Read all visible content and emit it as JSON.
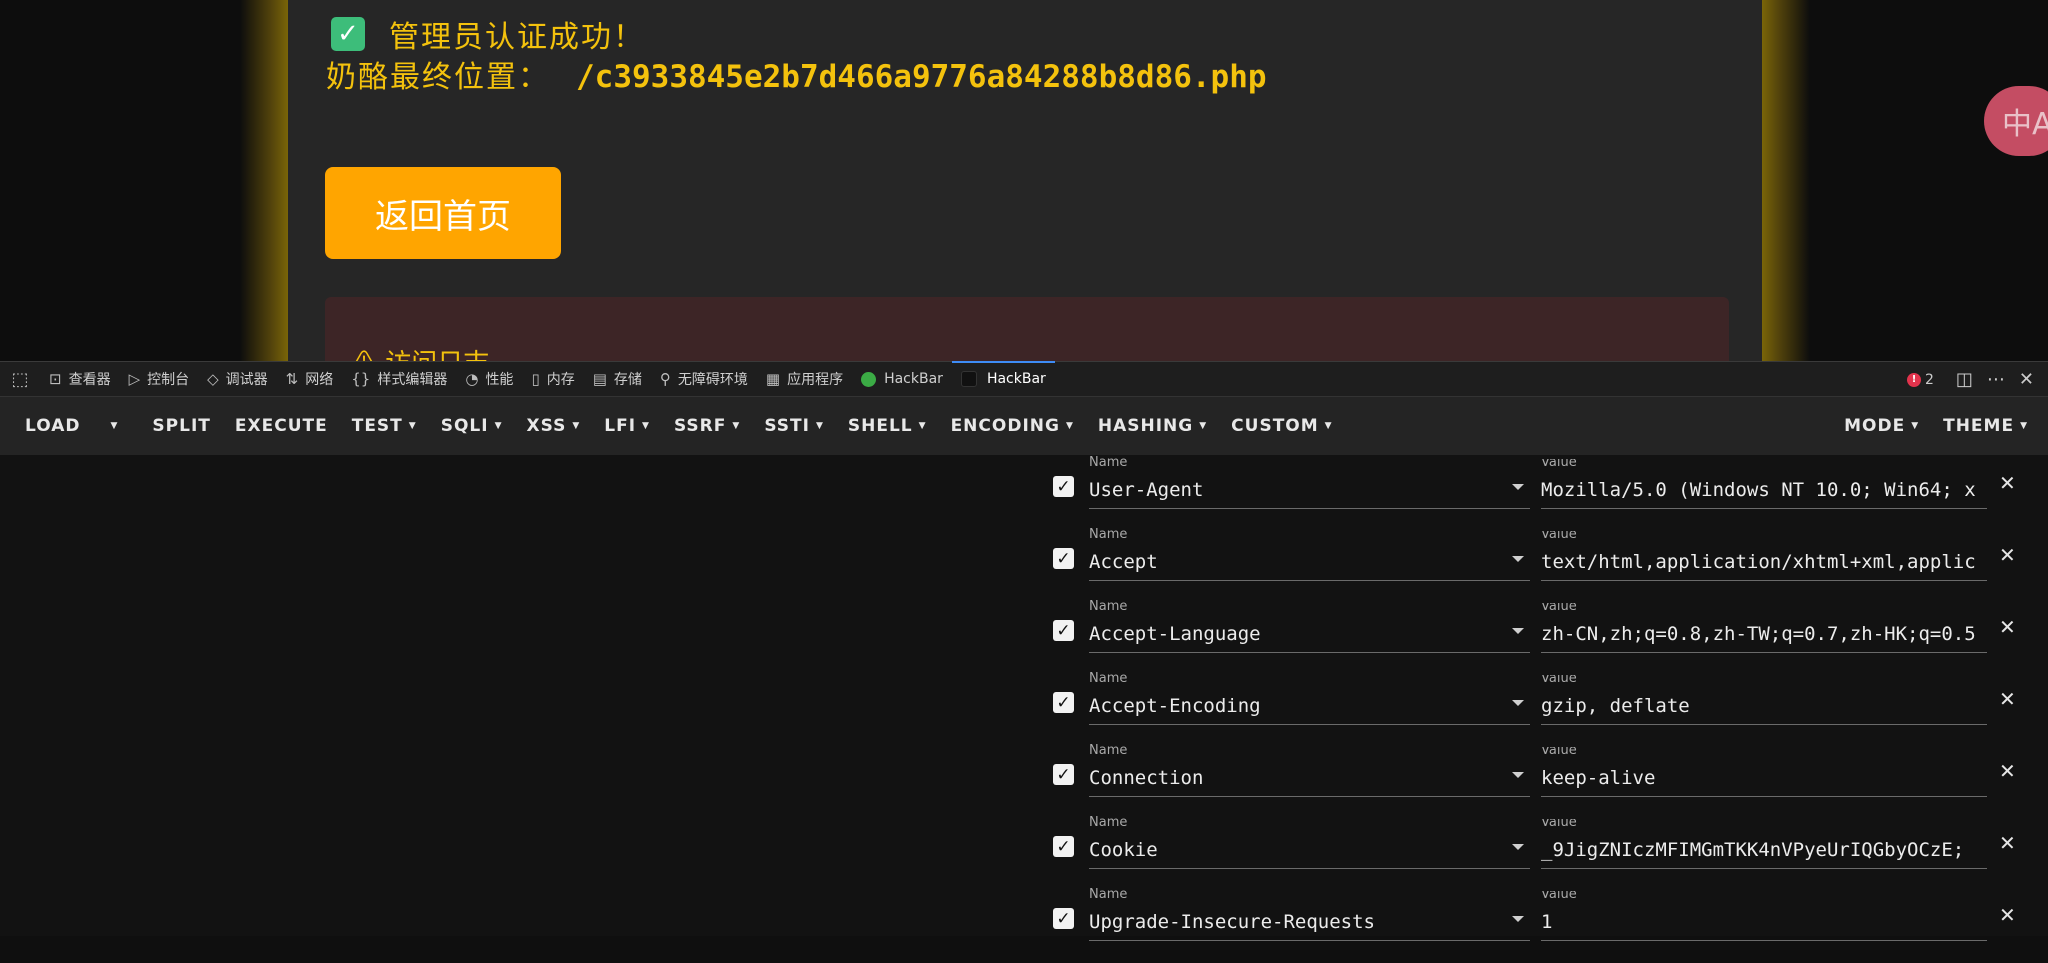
{
  "page": {
    "success_message": "管理员认证成功！",
    "location_label": "奶酪最终位置：",
    "location_path": "/c3933845e2b7d466a9776a84288b8d86.php",
    "home_button": "返回首页",
    "log_title": "⚠ 访问日志",
    "translate_icon": "中A"
  },
  "devtools": {
    "tabs": [
      {
        "icon": "inspector-icon",
        "glyph": "⊡",
        "label": "查看器"
      },
      {
        "icon": "console-icon",
        "glyph": "▷",
        "label": "控制台"
      },
      {
        "icon": "debugger-icon",
        "glyph": "◇",
        "label": "调试器"
      },
      {
        "icon": "network-icon",
        "glyph": "⇅",
        "label": "网络"
      },
      {
        "icon": "style-editor-icon",
        "glyph": "{}",
        "label": "样式编辑器"
      },
      {
        "icon": "performance-icon",
        "glyph": "◔",
        "label": "性能"
      },
      {
        "icon": "memory-icon",
        "glyph": "▯",
        "label": "内存"
      },
      {
        "icon": "storage-icon",
        "glyph": "▤",
        "label": "存储"
      },
      {
        "icon": "accessibility-icon",
        "glyph": "⚲",
        "label": "无障碍环境"
      },
      {
        "icon": "application-icon",
        "glyph": "▦",
        "label": "应用程序"
      },
      {
        "icon": "hackbar-green-icon",
        "label": "HackBar"
      },
      {
        "icon": "hackbar-dark-icon",
        "label": "HackBar"
      }
    ],
    "error_count": "2"
  },
  "hackbar": {
    "toolbar": [
      "LOAD",
      "SPLIT",
      "EXECUTE",
      "TEST",
      "SQLI",
      "XSS",
      "LFI",
      "SSRF",
      "SSTI",
      "SHELL",
      "ENCODING",
      "HASHING",
      "CUSTOM"
    ],
    "toolbar_right": [
      "MODE",
      "THEME"
    ],
    "field_name_label": "Name",
    "field_value_label": "Value",
    "headers": [
      {
        "name": "User-Agent",
        "value": "Mozilla/5.0 (Windows NT 10.0; Win64; x"
      },
      {
        "name": "Accept",
        "value": "text/html,application/xhtml+xml,applic"
      },
      {
        "name": "Accept-Language",
        "value": "zh-CN,zh;q=0.8,zh-TW;q=0.7,zh-HK;q=0.5"
      },
      {
        "name": "Accept-Encoding",
        "value": "gzip, deflate"
      },
      {
        "name": "Connection",
        "value": "keep-alive"
      },
      {
        "name": "Cookie",
        "value": "_9JigZNIczMFIMGmTKK4nVPyeUrIQGbyOCzE;"
      },
      {
        "name": "Upgrade-Insecure-Requests",
        "value": "1"
      }
    ]
  },
  "colors": {
    "accent": "#f4c20d",
    "button": "#ffa500",
    "check": "#3dbd7a"
  }
}
